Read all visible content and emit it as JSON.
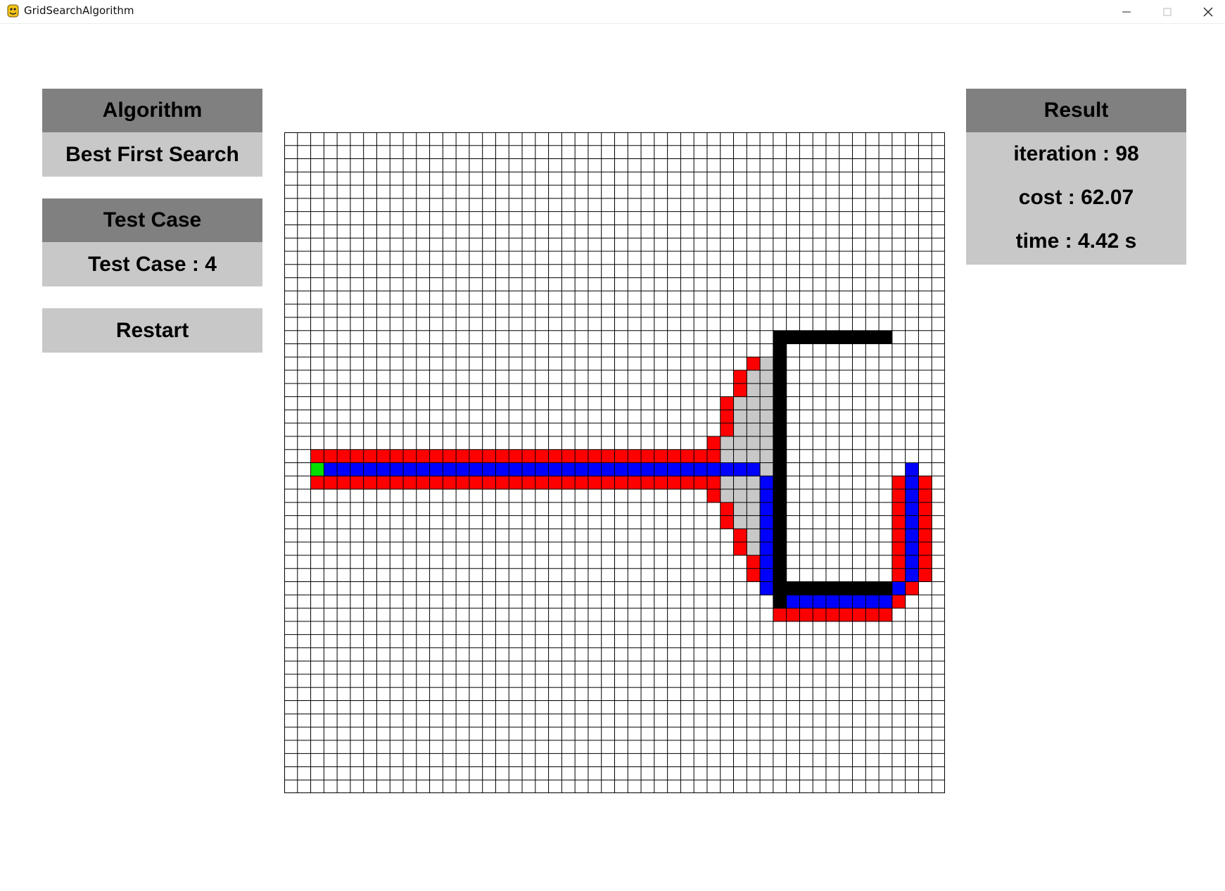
{
  "window": {
    "title": "GridSearchAlgorithm",
    "icon": "python-icon",
    "controls": [
      "minimize-icon",
      "maximize-icon",
      "close-icon"
    ]
  },
  "algorithm_panel": {
    "header": "Algorithm",
    "value": "Best First Search"
  },
  "testcase_panel": {
    "header": "Test Case",
    "value": "Test Case : 4"
  },
  "restart_button": {
    "label": "Restart"
  },
  "result_panel": {
    "header": "Result",
    "iteration": "iteration : 98",
    "cost": "cost : 62.07",
    "time": "time : 4.42 s"
  },
  "grid": {
    "rows": 50,
    "cols": 50,
    "colors": {
      "empty": "#ffffff",
      "gridline": "#000000",
      "wall": "#000000",
      "visited": "#c8c8c8",
      "frontier": "#ff0000",
      "path": "#0000ff",
      "start": "#00e000"
    },
    "start": [
      25,
      2
    ],
    "walls": [
      [
        15,
        37
      ],
      [
        15,
        38
      ],
      [
        15,
        39
      ],
      [
        15,
        40
      ],
      [
        15,
        41
      ],
      [
        15,
        42
      ],
      [
        15,
        43
      ],
      [
        15,
        44
      ],
      [
        15,
        45
      ],
      [
        16,
        37
      ],
      [
        17,
        37
      ],
      [
        18,
        37
      ],
      [
        19,
        37
      ],
      [
        20,
        37
      ],
      [
        21,
        37
      ],
      [
        22,
        37
      ],
      [
        23,
        37
      ],
      [
        24,
        37
      ],
      [
        25,
        37
      ],
      [
        26,
        37
      ],
      [
        27,
        37
      ],
      [
        28,
        37
      ],
      [
        29,
        37
      ],
      [
        30,
        37
      ],
      [
        31,
        37
      ],
      [
        32,
        37
      ],
      [
        33,
        37
      ],
      [
        34,
        37
      ],
      [
        35,
        37
      ],
      [
        34,
        38
      ],
      [
        34,
        39
      ],
      [
        34,
        40
      ],
      [
        34,
        41
      ],
      [
        34,
        42
      ],
      [
        34,
        43
      ],
      [
        34,
        44
      ],
      [
        34,
        45
      ]
    ],
    "path": [
      [
        25,
        3
      ],
      [
        25,
        4
      ],
      [
        25,
        5
      ],
      [
        25,
        6
      ],
      [
        25,
        7
      ],
      [
        25,
        8
      ],
      [
        25,
        9
      ],
      [
        25,
        10
      ],
      [
        25,
        11
      ],
      [
        25,
        12
      ],
      [
        25,
        13
      ],
      [
        25,
        14
      ],
      [
        25,
        15
      ],
      [
        25,
        16
      ],
      [
        25,
        17
      ],
      [
        25,
        18
      ],
      [
        25,
        19
      ],
      [
        25,
        20
      ],
      [
        25,
        21
      ],
      [
        25,
        22
      ],
      [
        25,
        23
      ],
      [
        25,
        24
      ],
      [
        25,
        25
      ],
      [
        25,
        26
      ],
      [
        25,
        27
      ],
      [
        25,
        28
      ],
      [
        25,
        29
      ],
      [
        25,
        30
      ],
      [
        25,
        31
      ],
      [
        25,
        32
      ],
      [
        25,
        33
      ],
      [
        25,
        34
      ],
      [
        25,
        35
      ],
      [
        26,
        36
      ],
      [
        27,
        36
      ],
      [
        28,
        36
      ],
      [
        29,
        36
      ],
      [
        30,
        36
      ],
      [
        31,
        36
      ],
      [
        32,
        36
      ],
      [
        33,
        36
      ],
      [
        34,
        36
      ],
      [
        35,
        37
      ],
      [
        35,
        38
      ],
      [
        35,
        39
      ],
      [
        35,
        40
      ],
      [
        35,
        41
      ],
      [
        35,
        42
      ],
      [
        35,
        43
      ],
      [
        35,
        44
      ],
      [
        35,
        45
      ],
      [
        34,
        46
      ],
      [
        33,
        47
      ],
      [
        32,
        47
      ],
      [
        31,
        47
      ],
      [
        30,
        47
      ],
      [
        29,
        47
      ],
      [
        28,
        47
      ],
      [
        27,
        47
      ],
      [
        26,
        47
      ],
      [
        25,
        47
      ]
    ],
    "visited": [
      [
        17,
        36
      ],
      [
        18,
        35
      ],
      [
        18,
        36
      ],
      [
        19,
        35
      ],
      [
        19,
        36
      ],
      [
        20,
        34
      ],
      [
        20,
        35
      ],
      [
        20,
        36
      ],
      [
        21,
        34
      ],
      [
        21,
        35
      ],
      [
        21,
        36
      ],
      [
        22,
        34
      ],
      [
        22,
        35
      ],
      [
        22,
        36
      ],
      [
        23,
        33
      ],
      [
        23,
        34
      ],
      [
        23,
        35
      ],
      [
        23,
        36
      ],
      [
        24,
        33
      ],
      [
        24,
        34
      ],
      [
        24,
        35
      ],
      [
        24,
        36
      ],
      [
        25,
        36
      ],
      [
        26,
        33
      ],
      [
        26,
        34
      ],
      [
        26,
        35
      ],
      [
        27,
        33
      ],
      [
        27,
        34
      ],
      [
        27,
        35
      ],
      [
        28,
        34
      ],
      [
        28,
        35
      ],
      [
        29,
        34
      ],
      [
        29,
        35
      ],
      [
        30,
        34
      ],
      [
        30,
        35
      ],
      [
        31,
        35
      ],
      [
        32,
        35
      ]
    ],
    "frontier": [
      [
        24,
        2
      ],
      [
        24,
        3
      ],
      [
        24,
        4
      ],
      [
        24,
        5
      ],
      [
        24,
        6
      ],
      [
        24,
        7
      ],
      [
        24,
        8
      ],
      [
        24,
        9
      ],
      [
        24,
        10
      ],
      [
        24,
        11
      ],
      [
        24,
        12
      ],
      [
        24,
        13
      ],
      [
        24,
        14
      ],
      [
        24,
        15
      ],
      [
        24,
        16
      ],
      [
        24,
        17
      ],
      [
        24,
        18
      ],
      [
        24,
        19
      ],
      [
        24,
        20
      ],
      [
        24,
        21
      ],
      [
        24,
        22
      ],
      [
        24,
        23
      ],
      [
        24,
        24
      ],
      [
        24,
        25
      ],
      [
        24,
        26
      ],
      [
        24,
        27
      ],
      [
        24,
        28
      ],
      [
        24,
        29
      ],
      [
        24,
        30
      ],
      [
        24,
        31
      ],
      [
        24,
        32
      ],
      [
        26,
        2
      ],
      [
        26,
        3
      ],
      [
        26,
        4
      ],
      [
        26,
        5
      ],
      [
        26,
        6
      ],
      [
        26,
        7
      ],
      [
        26,
        8
      ],
      [
        26,
        9
      ],
      [
        26,
        10
      ],
      [
        26,
        11
      ],
      [
        26,
        12
      ],
      [
        26,
        13
      ],
      [
        26,
        14
      ],
      [
        26,
        15
      ],
      [
        26,
        16
      ],
      [
        26,
        17
      ],
      [
        26,
        18
      ],
      [
        26,
        19
      ],
      [
        26,
        20
      ],
      [
        26,
        21
      ],
      [
        26,
        22
      ],
      [
        26,
        23
      ],
      [
        26,
        24
      ],
      [
        26,
        25
      ],
      [
        26,
        26
      ],
      [
        26,
        27
      ],
      [
        26,
        28
      ],
      [
        26,
        29
      ],
      [
        26,
        30
      ],
      [
        26,
        31
      ],
      [
        26,
        32
      ],
      [
        23,
        32
      ],
      [
        27,
        32
      ],
      [
        17,
        35
      ],
      [
        18,
        34
      ],
      [
        19,
        34
      ],
      [
        20,
        33
      ],
      [
        21,
        33
      ],
      [
        22,
        33
      ],
      [
        28,
        33
      ],
      [
        29,
        33
      ],
      [
        30,
        34
      ],
      [
        31,
        34
      ],
      [
        32,
        35
      ],
      [
        33,
        35
      ],
      [
        34,
        36
      ],
      [
        36,
        37
      ],
      [
        36,
        38
      ],
      [
        36,
        39
      ],
      [
        36,
        40
      ],
      [
        36,
        41
      ],
      [
        36,
        42
      ],
      [
        36,
        43
      ],
      [
        36,
        44
      ],
      [
        36,
        45
      ],
      [
        35,
        46
      ],
      [
        34,
        45
      ],
      [
        33,
        46
      ],
      [
        34,
        47
      ],
      [
        33,
        48
      ],
      [
        26,
        46
      ],
      [
        27,
        46
      ],
      [
        28,
        46
      ],
      [
        29,
        46
      ],
      [
        30,
        46
      ],
      [
        31,
        46
      ],
      [
        32,
        46
      ],
      [
        26,
        48
      ],
      [
        27,
        48
      ],
      [
        28,
        48
      ],
      [
        29,
        48
      ],
      [
        30,
        48
      ],
      [
        31,
        48
      ],
      [
        32,
        48
      ]
    ]
  }
}
